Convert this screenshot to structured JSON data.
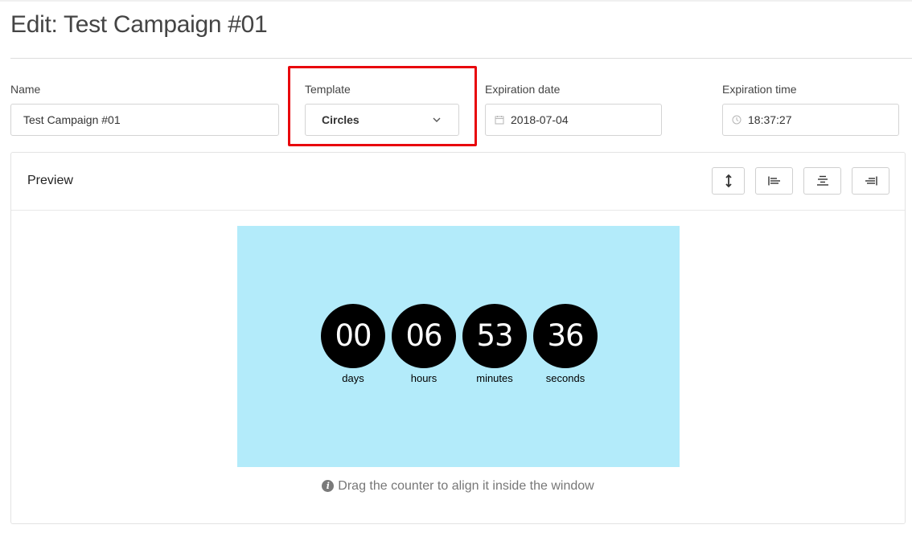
{
  "page": {
    "title": "Edit: Test Campaign #01"
  },
  "form": {
    "name": {
      "label": "Name",
      "value": "Test Campaign #01"
    },
    "template": {
      "label": "Template",
      "selected": "Circles"
    },
    "expiration_date": {
      "label": "Expiration date",
      "value": "2018-07-04",
      "icon": "calendar-icon"
    },
    "expiration_time": {
      "label": "Expiration time",
      "value": "18:37:27",
      "icon": "clock-icon"
    }
  },
  "preview": {
    "title": "Preview",
    "toolbar": [
      "vertical-align-icon",
      "align-left-icon",
      "align-center-icon",
      "align-right-icon"
    ],
    "background_color": "#b3ebfa",
    "counter": [
      {
        "value": "00",
        "label": "days"
      },
      {
        "value": "06",
        "label": "hours"
      },
      {
        "value": "53",
        "label": "minutes"
      },
      {
        "value": "36",
        "label": "seconds"
      }
    ],
    "hint": "Drag the counter to align it inside the window"
  },
  "colors": {
    "highlight": "#e8060c",
    "circle": "#000000"
  }
}
